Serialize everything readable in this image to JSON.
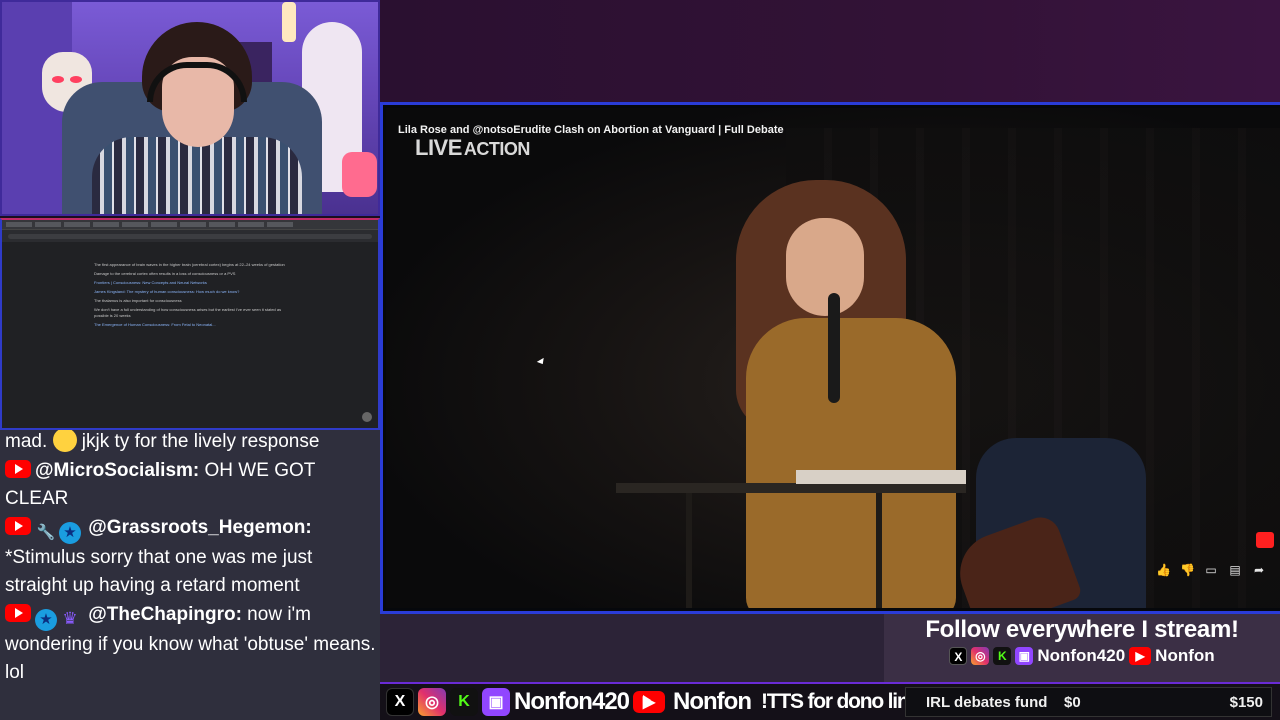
{
  "video": {
    "title": "Lila Rose and @notsoErudite  Clash on Abortion at Vanguard | Full Debate",
    "logo_main": "LIVE",
    "logo_sub": "ACTION"
  },
  "browser": {
    "lines": [
      "The first appearance of brain waves in the higher brain (cerebral cortex) begins at 22–24 weeks of gestation",
      "Damage to the cerebral cortex often results in a loss of consciousness or a PVS",
      "Frontiers | Consciousness: New Concepts and Neural Networks",
      "James Kingsland: The mystery of human consciousness: How much do we know?",
      "The thalamus is also important for consciousness",
      "We don't have a full understanding of how consciousness arises but the earliest I've ever seen it stated as possible is 20 weeks",
      "The Emergence of Human Consciousness: From Fetal to Neonatal..."
    ]
  },
  "chat": {
    "top_fragment": "mad.",
    "top_text": " jkjk ty for the lively response",
    "messages": [
      {
        "user": "@MicroSocialism:",
        "text": " OH WE GOT CLEAR"
      },
      {
        "user": "@Grassroots_Hegemon:",
        "text": " *Stimulus sorry that one was me just straight up having a retard moment"
      },
      {
        "user": "@TheChapingro:",
        "text": " now i'm wondering if you know what 'obtuse' means. lol"
      }
    ]
  },
  "follow": {
    "title": "Follow everywhere I stream!",
    "handle1": "Nonfon420",
    "handle2": "Nonfon"
  },
  "bottom": {
    "handle1": "Nonfon420",
    "handle2": "Nonfon",
    "tts": "!TTS for dono link",
    "fund_label": "IRL debates fund",
    "fund_current": "$0",
    "fund_goal": "$150"
  },
  "colors": {
    "accent_blue": "#2a3cd8",
    "accent_purple": "#6a2bd6",
    "youtube_red": "#ff0000",
    "chat_bg": "#2f2f3d"
  }
}
